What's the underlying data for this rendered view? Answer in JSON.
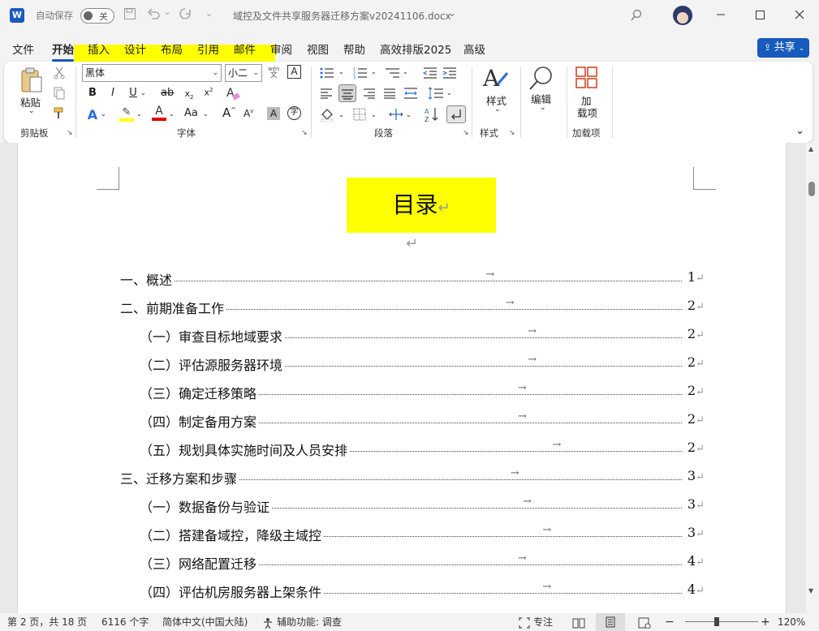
{
  "titlebar": {
    "app_icon": "W",
    "autosave_label": "自动保存",
    "autosave_state": "关",
    "doc_title": "域控及文件共享服务器迁移方案v20241106.docx",
    "chevron": "⌄"
  },
  "menu": {
    "tabs": [
      "文件",
      "开始",
      "插入",
      "设计",
      "布局",
      "引用",
      "邮件",
      "审阅",
      "视图",
      "帮助",
      "高效排版2025",
      "高级"
    ],
    "active": "开始",
    "share_label": "共享"
  },
  "ribbon": {
    "clipboard": {
      "paste_label": "粘贴",
      "group_label": "剪贴板"
    },
    "font": {
      "font_name": "黑体",
      "font_size": "小二",
      "phonetic_label": "wén",
      "phonetic_sub": "文",
      "border_char": "A",
      "bold": "B",
      "italic": "I",
      "underline": "U",
      "strike": "ab",
      "sub": "x",
      "sup": "x",
      "clear_fmt": "A",
      "effects": "A",
      "highlight": "✎",
      "color": "A",
      "case": "Aa",
      "grow": "A",
      "shrink": "A",
      "shade": "A",
      "enclose": "字",
      "group_label": "字体"
    },
    "paragraph": {
      "group_label": "段落"
    },
    "styles": {
      "label": "样式",
      "group_label": "样式"
    },
    "editing": {
      "label": "编辑"
    },
    "addins": {
      "label1": "加",
      "label2": "载项",
      "group_label": "加载项"
    }
  },
  "document": {
    "title": "目录",
    "highlight_color": "#ffff00",
    "toc": [
      {
        "text": "一、概述",
        "page": "1",
        "level": 1
      },
      {
        "text": "二、前期准备工作",
        "page": "2",
        "level": 1
      },
      {
        "text": "（一）审查目标地域要求",
        "page": "2",
        "level": 2
      },
      {
        "text": "（二）评估源服务器环境",
        "page": "2",
        "level": 2
      },
      {
        "text": "（三）确定迁移策略",
        "page": "2",
        "level": 2
      },
      {
        "text": "（四）制定备用方案",
        "page": "2",
        "level": 2
      },
      {
        "text": "（五）规划具体实施时间及人员安排",
        "page": "2",
        "level": 2
      },
      {
        "text": "三、迁移方案和步骤",
        "page": "3",
        "level": 1
      },
      {
        "text": "（一）数据备份与验证",
        "page": "3",
        "level": 2
      },
      {
        "text": "（二）搭建备域控，降级主域控",
        "page": "3",
        "level": 2
      },
      {
        "text": "（三）网络配置迁移",
        "page": "4",
        "level": 2
      },
      {
        "text": "（四）评估机房服务器上架条件",
        "page": "4",
        "level": 2
      }
    ]
  },
  "status": {
    "page": "第 2 页，共 18 页",
    "words": "6116 个字",
    "language": "简体中文(中国大陆)",
    "accessibility": "辅助功能: 调查",
    "focus": "专注",
    "zoom_minus": "−",
    "zoom_plus": "+",
    "zoom": "120%"
  },
  "colors": {
    "accent": "#185abd",
    "highlight": "#ffff00"
  }
}
